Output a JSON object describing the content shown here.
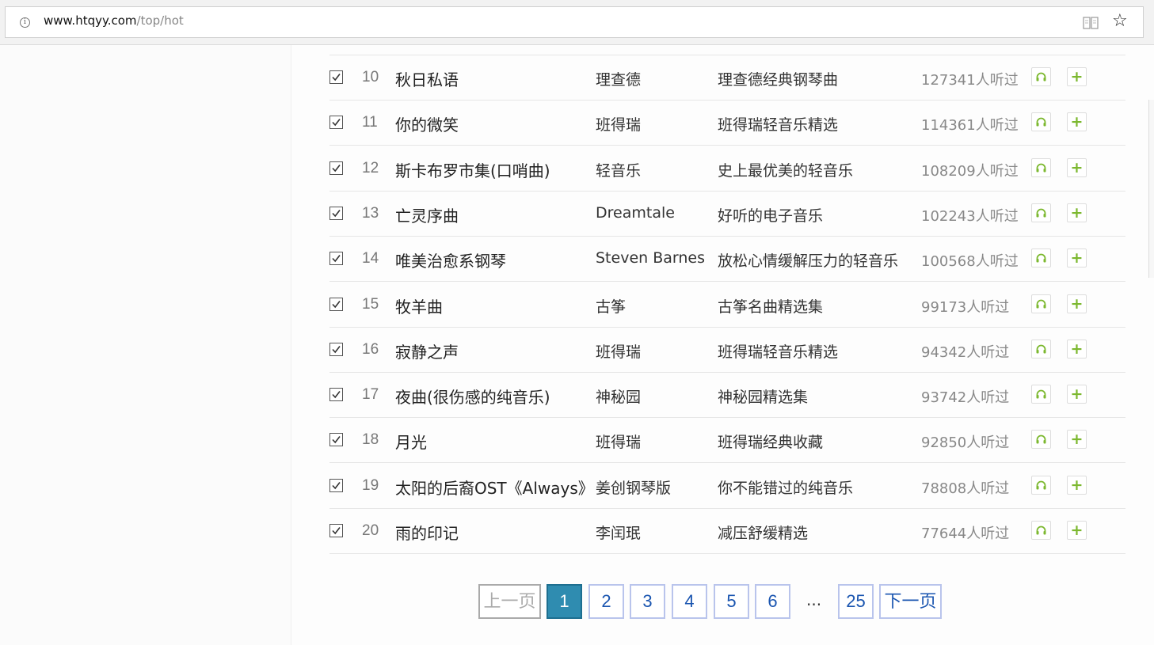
{
  "browser": {
    "url_host": "www.htqyy.com",
    "url_path": "/top/hot",
    "icons": [
      "info-icon",
      "reader-view-icon",
      "favorite-star-icon"
    ]
  },
  "songs": [
    {
      "num": "10",
      "title": "秋日私语",
      "artist": "理查德",
      "album": "理查德经典钢琴曲",
      "plays": "127341人听过"
    },
    {
      "num": "11",
      "title": "你的微笑",
      "artist": "班得瑞",
      "album": "班得瑞轻音乐精选",
      "plays": "114361人听过"
    },
    {
      "num": "12",
      "title": "斯卡布罗市集(口哨曲)",
      "artist": "轻音乐",
      "album": "史上最优美的轻音乐",
      "plays": "108209人听过"
    },
    {
      "num": "13",
      "title": "亡灵序曲",
      "artist": "Dreamtale",
      "album": "好听的电子音乐",
      "plays": "102243人听过"
    },
    {
      "num": "14",
      "title": "唯美治愈系钢琴",
      "artist": "Steven Barnes",
      "album": "放松心情缓解压力的轻音乐",
      "plays": "100568人听过"
    },
    {
      "num": "15",
      "title": "牧羊曲",
      "artist": "古筝",
      "album": "古筝名曲精选集",
      "plays": "99173人听过"
    },
    {
      "num": "16",
      "title": "寂静之声",
      "artist": "班得瑞",
      "album": "班得瑞轻音乐精选",
      "plays": "94342人听过"
    },
    {
      "num": "17",
      "title": "夜曲(很伤感的纯音乐)",
      "artist": "神秘园",
      "album": "神秘园精选集",
      "plays": "93742人听过"
    },
    {
      "num": "18",
      "title": "月光",
      "artist": "班得瑞",
      "album": "班得瑞经典收藏",
      "plays": "92850人听过"
    },
    {
      "num": "19",
      "title": "太阳的后裔OST《Always》",
      "artist": "姜创钢琴版",
      "album": "你不能错过的纯音乐",
      "plays": "78808人听过"
    },
    {
      "num": "20",
      "title": "雨的印记",
      "artist": "李闰珉",
      "album": "减压舒缓精选",
      "plays": "77644人听过"
    }
  ],
  "row_buttons": {
    "listen_icon": "headphones-icon",
    "add_label": "+"
  },
  "pagination": {
    "prev": "上一页",
    "pages": [
      "1",
      "2",
      "3",
      "4",
      "5",
      "6"
    ],
    "ellipsis": "...",
    "last": "25",
    "next": "下一页",
    "current": "1"
  },
  "colors": {
    "accent_green": "#7cb82f",
    "active_page": "#2f8cb0",
    "page_border": "#b9c4ec",
    "link_blue": "#1a55b0"
  }
}
